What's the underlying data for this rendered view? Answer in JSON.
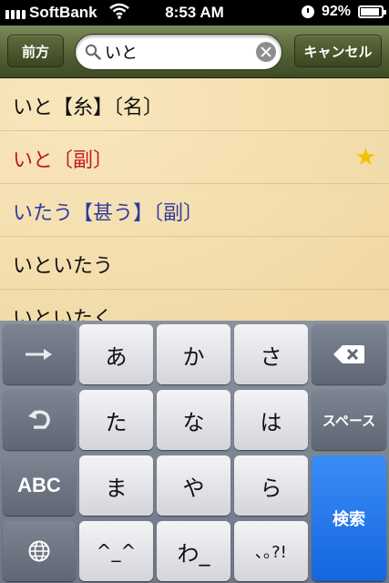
{
  "status_bar": {
    "carrier": "SoftBank",
    "time": "8:53 AM",
    "battery": "92%",
    "battery_level": 0.92
  },
  "toolbar": {
    "back_label": "前方",
    "search_value": "いと",
    "cancel_label": "キャンセル"
  },
  "results": [
    {
      "text": "いと【糸】〔名〕",
      "color": "#111111",
      "starred": false
    },
    {
      "text": "いと〔副〕",
      "color": "#c0181a",
      "starred": true
    },
    {
      "text": "いたう【甚う】〔副〕",
      "color": "#2f3a9e",
      "starred": false
    },
    {
      "text": "いといたう",
      "color": "#111111",
      "starred": false
    },
    {
      "text": "いといたく",
      "color": "#111111",
      "starred": false
    }
  ],
  "keyboard": {
    "row1": [
      "あ",
      "か",
      "さ"
    ],
    "row2": [
      "た",
      "な",
      "は"
    ],
    "row3": [
      "ま",
      "や",
      "ら"
    ],
    "row4": [
      "^_^",
      "わ_",
      "､｡?!"
    ],
    "space_label": "スペース",
    "abc_label": "ABC",
    "search_label": "検索",
    "icons": {
      "next": "arrow-right-icon",
      "undo": "undo-icon",
      "globe": "globe-icon",
      "delete": "delete-icon"
    }
  }
}
